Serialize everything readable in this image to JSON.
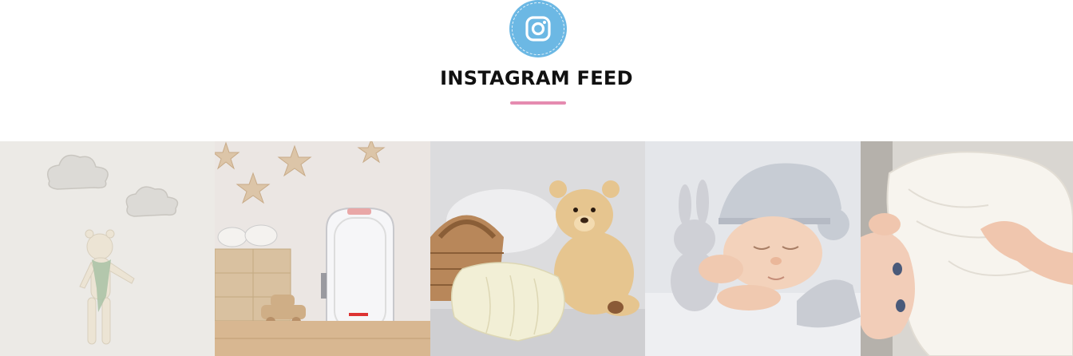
{
  "section": {
    "title": "INSTAGRAM FEED",
    "icon": "instagram-icon",
    "accent_color": "#e58bb0",
    "badge_color": "#6cb8e4"
  },
  "feed": {
    "posts": [
      {
        "subject": "crochet-teddy-and-clouds"
      },
      {
        "subject": "nursery-shelf-with-appliance"
      },
      {
        "subject": "teddy-bear-with-basket"
      },
      {
        "subject": "sleeping-baby-in-knit-hat"
      },
      {
        "subject": "baby-under-white-blanket"
      }
    ]
  }
}
